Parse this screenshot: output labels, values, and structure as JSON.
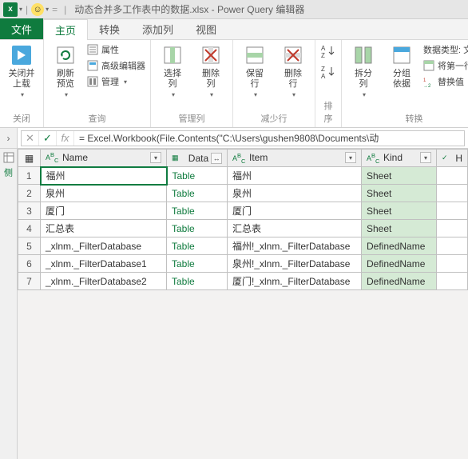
{
  "titlebar": {
    "app_title": "动态合并多工作表中的数据.xlsx - Power Query 编辑器"
  },
  "tabs": {
    "file": "文件",
    "home": "主页",
    "transform": "转换",
    "addcolumn": "添加列",
    "view": "视图"
  },
  "ribbon": {
    "close": {
      "label": "关闭并\n上载",
      "group": "关闭"
    },
    "query": {
      "refresh": "刷新\n预览",
      "properties": "属性",
      "adv_editor": "高级编辑器",
      "manage": "管理",
      "group": "查询"
    },
    "cols": {
      "choose": "选择\n列",
      "remove": "删除\n列",
      "group": "管理列"
    },
    "rows": {
      "keep": "保留\n行",
      "remove": "删除\n行",
      "group": "减少行"
    },
    "sort": {
      "group": "排序"
    },
    "split": "拆分\n列",
    "groupby": "分组\n依据",
    "transform": {
      "datatype": "数据类型: 文本",
      "firstrow": "将第一行用",
      "replace": "替换值",
      "group": "转换"
    }
  },
  "formula": "= Excel.Workbook(File.Contents(\"C:\\Users\\gushen9808\\Documents\\动",
  "columns": {
    "corner": "",
    "name": "Name",
    "data": "Data",
    "item": "Item",
    "kind": "Kind",
    "hidden": "H"
  },
  "rows": [
    {
      "n": "1",
      "name": "福州",
      "data": "Table",
      "item": "福州",
      "kind": "Sheet"
    },
    {
      "n": "2",
      "name": "泉州",
      "data": "Table",
      "item": "泉州",
      "kind": "Sheet"
    },
    {
      "n": "3",
      "name": "厦门",
      "data": "Table",
      "item": "厦门",
      "kind": "Sheet"
    },
    {
      "n": "4",
      "name": "汇总表",
      "data": "Table",
      "item": "汇总表",
      "kind": "Sheet"
    },
    {
      "n": "5",
      "name": "_xlnm._FilterDatabase",
      "data": "Table",
      "item": "福州!_xlnm._FilterDatabase",
      "kind": "DefinedName"
    },
    {
      "n": "6",
      "name": "_xlnm._FilterDatabase1",
      "data": "Table",
      "item": "泉州!_xlnm._FilterDatabase",
      "kind": "DefinedName"
    },
    {
      "n": "7",
      "name": "_xlnm._FilterDatabase2",
      "data": "Table",
      "item": "厦门!_xlnm._FilterDatabase",
      "kind": "DefinedName"
    }
  ]
}
